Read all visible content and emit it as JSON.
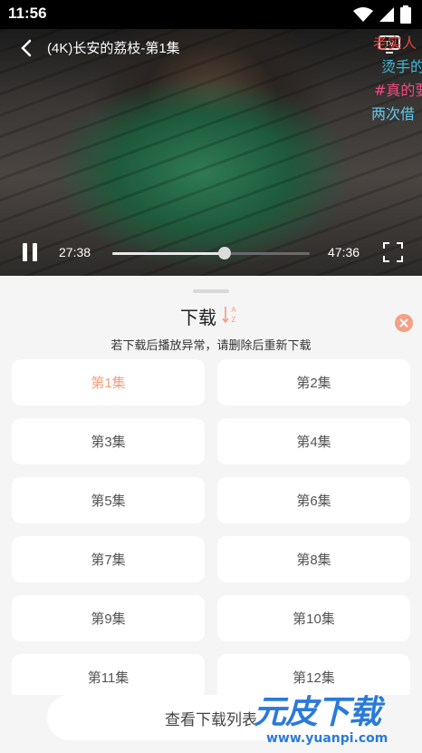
{
  "status_bar": {
    "time": "11:56"
  },
  "player": {
    "title": "(4K)长安的荔枝-第1集",
    "current_time": "27:38",
    "total_time": "47:36",
    "progress": 0.57,
    "tv_label": "TV",
    "danmaku": [
      {
        "text": "老实人",
        "color": "#e5433a"
      },
      {
        "text": "烫手的",
        "color": "#3fb8d8"
      },
      {
        "text": "#真的要",
        "color": "#ef4a86"
      },
      {
        "text": "两次借",
        "color": "#5fc8ee"
      }
    ]
  },
  "sheet": {
    "title": "下载",
    "sort_icon_labels": {
      "top": "A",
      "bottom": "Z"
    },
    "notice": "若下载后播放异常，请删除后重新下载",
    "episodes": [
      "第1集",
      "第2集",
      "第3集",
      "第4集",
      "第5集",
      "第6集",
      "第7集",
      "第8集",
      "第9集",
      "第10集",
      "第11集",
      "第12集"
    ],
    "selected_episode": "第1集",
    "bottom_button": "查看下载列表"
  },
  "watermark": {
    "logo": "元皮下载",
    "url": "www.yuanpi.com"
  },
  "colors": {
    "accent": "#f0a07e",
    "close": "#f3a084",
    "watermark": "#2b7ad8"
  }
}
